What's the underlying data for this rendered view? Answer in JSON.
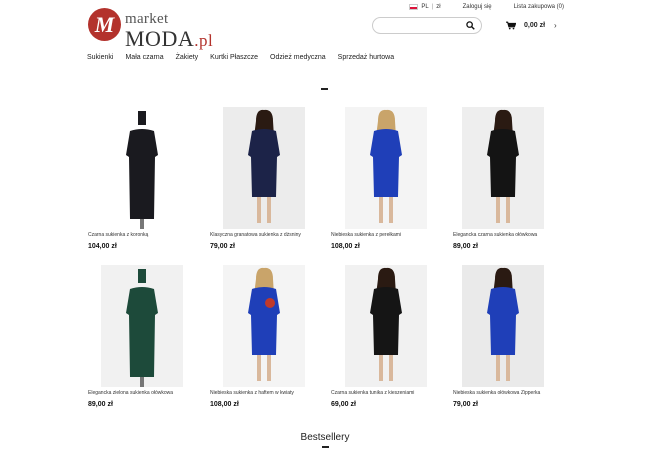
{
  "logo": {
    "mark": "M",
    "small": "market",
    "big": "MODA",
    "suffix": ".pl"
  },
  "topbar": {
    "lang": "PL",
    "currency": "zł",
    "login": "Zaloguj się",
    "wishlist": "Lista zakupowa (0)"
  },
  "search": {
    "placeholder": ""
  },
  "cart": {
    "total": "0,00 zł"
  },
  "nav": [
    "Sukienki",
    "Mała czarna",
    "Żakiety",
    "Kurtki Płaszcze",
    "Odzież medyczna",
    "Sprzedaż hurtowa"
  ],
  "products": [
    {
      "name": "Czarna sukienka z koronką",
      "price": "104,00 zł",
      "dress_color": "#1a1a1f",
      "bg": "#ffffff"
    },
    {
      "name": "Klasyczna granatowa sukienka z dżsniny",
      "price": "79,00 zł",
      "dress_color": "#1c2348",
      "bg": "#ececec"
    },
    {
      "name": "Niebieska sukienka z perełkami",
      "price": "108,00 zł",
      "dress_color": "#1f3fb8",
      "bg": "#f4f4f4"
    },
    {
      "name": "Elegancka czarna sukienka ołówkowa",
      "price": "89,00 zł",
      "dress_color": "#141414",
      "bg": "#eeeeee"
    },
    {
      "name": "Elegancka zielona sukienka ołówkowa",
      "price": "89,00 zł",
      "dress_color": "#1d4a3a",
      "bg": "#f1f1f1"
    },
    {
      "name": "Niebieska sukienka z haftem w kwiaty",
      "price": "108,00 zł",
      "dress_color": "#1f3fb8",
      "bg": "#f4f4f4"
    },
    {
      "name": "Czarna sukienka tunika z kieszeniami",
      "price": "69,00 zł",
      "dress_color": "#151515",
      "bg": "#f1f1f1"
    },
    {
      "name": "Niebieska sukienka ołówkowa Zipperka",
      "price": "79,00 zł",
      "dress_color": "#1f3fb8",
      "bg": "#eaeaea"
    }
  ],
  "bestsellery": "Bestsellery"
}
